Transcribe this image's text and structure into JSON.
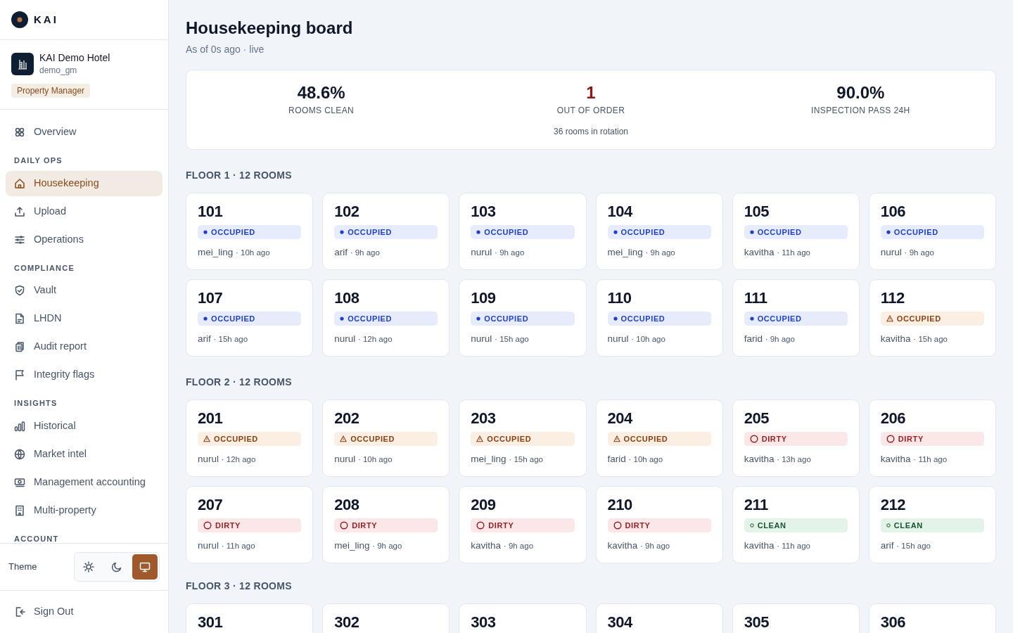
{
  "brand": {
    "name": "KAI"
  },
  "property": {
    "name": "KAI Demo Hotel",
    "user": "demo_gm",
    "role": "Property Manager"
  },
  "nav": [
    {
      "kind": "item",
      "label": "Overview",
      "selected": false
    },
    {
      "kind": "heading",
      "label": "DAILY OPS"
    },
    {
      "kind": "item",
      "label": "Housekeeping",
      "selected": true
    },
    {
      "kind": "item",
      "label": "Upload",
      "selected": false
    },
    {
      "kind": "item",
      "label": "Operations",
      "selected": false
    },
    {
      "kind": "heading",
      "label": "COMPLIANCE"
    },
    {
      "kind": "item",
      "label": "Vault",
      "selected": false
    },
    {
      "kind": "item",
      "label": "LHDN",
      "selected": false
    },
    {
      "kind": "item",
      "label": "Audit report",
      "selected": false
    },
    {
      "kind": "item",
      "label": "Integrity flags",
      "selected": false
    },
    {
      "kind": "heading",
      "label": "INSIGHTS"
    },
    {
      "kind": "item",
      "label": "Historical",
      "selected": false
    },
    {
      "kind": "item",
      "label": "Market intel",
      "selected": false
    },
    {
      "kind": "item",
      "label": "Management accounting",
      "selected": false
    },
    {
      "kind": "item",
      "label": "Multi-property",
      "selected": false
    },
    {
      "kind": "heading",
      "label": "ACCOUNT"
    }
  ],
  "theme": {
    "label": "Theme",
    "options": [
      {
        "selected": false
      },
      {
        "selected": false
      },
      {
        "selected": true
      }
    ]
  },
  "sign_out": "Sign Out",
  "page": {
    "title": "Housekeeping board",
    "subtitle": "As of 0s ago · live"
  },
  "stats": [
    {
      "value": "48.6%",
      "label": "ROOMS CLEAN",
      "kind": "normal"
    },
    {
      "value": "1",
      "label": "OUT OF ORDER",
      "kind": "danger",
      "note": "36 rooms in rotation"
    },
    {
      "value": "90.0%",
      "label": "INSPECTION PASS 24H",
      "kind": "normal"
    }
  ],
  "floors": [
    {
      "title": "FLOOR 1 · 12 ROOMS",
      "rooms": [
        {
          "number": "101",
          "kind": "occupied",
          "status": "OCCUPIED",
          "staff": "mei_ling",
          "time": "· 10h ago"
        },
        {
          "number": "102",
          "kind": "occupied",
          "status": "OCCUPIED",
          "staff": "arif",
          "time": "· 9h ago"
        },
        {
          "number": "103",
          "kind": "occupied",
          "status": "OCCUPIED",
          "staff": "nurul",
          "time": "· 9h ago"
        },
        {
          "number": "104",
          "kind": "occupied",
          "status": "OCCUPIED",
          "staff": "mei_ling",
          "time": "· 9h ago"
        },
        {
          "number": "105",
          "kind": "occupied",
          "status": "OCCUPIED",
          "staff": "kavitha",
          "time": "· 11h ago"
        },
        {
          "number": "106",
          "kind": "occupied",
          "status": "OCCUPIED",
          "staff": "nurul",
          "time": "· 9h ago"
        },
        {
          "number": "107",
          "kind": "occupied",
          "status": "OCCUPIED",
          "staff": "arif",
          "time": "· 15h ago"
        },
        {
          "number": "108",
          "kind": "occupied",
          "status": "OCCUPIED",
          "staff": "nurul",
          "time": "· 12h ago"
        },
        {
          "number": "109",
          "kind": "occupied",
          "status": "OCCUPIED",
          "staff": "nurul",
          "time": "· 15h ago"
        },
        {
          "number": "110",
          "kind": "occupied",
          "status": "OCCUPIED",
          "staff": "nurul",
          "time": "· 10h ago"
        },
        {
          "number": "111",
          "kind": "occupied",
          "status": "OCCUPIED",
          "staff": "farid",
          "time": "· 9h ago"
        },
        {
          "number": "112",
          "kind": "warning",
          "status": "OCCUPIED",
          "staff": "kavitha",
          "time": "· 15h ago"
        }
      ]
    },
    {
      "title": "FLOOR 2 · 12 ROOMS",
      "rooms": [
        {
          "number": "201",
          "kind": "warning",
          "status": "OCCUPIED",
          "staff": "nurul",
          "time": "· 12h ago"
        },
        {
          "number": "202",
          "kind": "warning",
          "status": "OCCUPIED",
          "staff": "nurul",
          "time": "· 10h ago"
        },
        {
          "number": "203",
          "kind": "warning",
          "status": "OCCUPIED",
          "staff": "mei_ling",
          "time": "· 15h ago"
        },
        {
          "number": "204",
          "kind": "warning",
          "status": "OCCUPIED",
          "staff": "farid",
          "time": "· 10h ago"
        },
        {
          "number": "205",
          "kind": "dirty",
          "status": "DIRTY",
          "staff": "kavitha",
          "time": "· 13h ago"
        },
        {
          "number": "206",
          "kind": "dirty",
          "status": "DIRTY",
          "staff": "kavitha",
          "time": "· 11h ago"
        },
        {
          "number": "207",
          "kind": "dirty",
          "status": "DIRTY",
          "staff": "nurul",
          "time": "· 11h ago"
        },
        {
          "number": "208",
          "kind": "dirty",
          "status": "DIRTY",
          "staff": "mei_ling",
          "time": "· 9h ago"
        },
        {
          "number": "209",
          "kind": "dirty",
          "status": "DIRTY",
          "staff": "kavitha",
          "time": "· 9h ago"
        },
        {
          "number": "210",
          "kind": "dirty",
          "status": "DIRTY",
          "staff": "kavitha",
          "time": "· 9h ago"
        },
        {
          "number": "211",
          "kind": "clean",
          "status": "CLEAN",
          "staff": "kavitha",
          "time": "· 11h ago"
        },
        {
          "number": "212",
          "kind": "clean",
          "status": "CLEAN",
          "staff": "arif",
          "time": "· 15h ago"
        }
      ]
    },
    {
      "title": "FLOOR 3 · 12 ROOMS",
      "rooms": [
        {
          "number": "301"
        },
        {
          "number": "302"
        },
        {
          "number": "303"
        },
        {
          "number": "304"
        },
        {
          "number": "305"
        },
        {
          "number": "306"
        }
      ]
    }
  ]
}
